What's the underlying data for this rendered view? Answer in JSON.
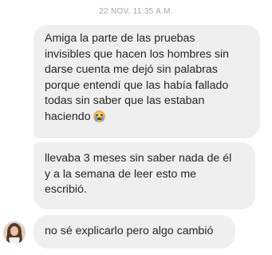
{
  "thread": {
    "timestamp": "22 NOV, 11:35 A.M.",
    "messages": [
      {
        "lines": [
          "Amiga la parte de las pruebas",
          "invisibles que hacen los hombres sin",
          "darse cuenta me dejó sin palabras",
          "porque entendí que las había fallado",
          "todas sin saber que las estaban",
          "haciendo"
        ],
        "emoji": "crying-face-emoji"
      },
      {
        "lines": [
          "llevaba 3 meses sin saber nada de él",
          "y a la semana de leer esto me",
          "escribió."
        ]
      },
      {
        "lines": [
          "no sé explicarlo pero algo cambió"
        ]
      }
    ],
    "avatar": "sender-avatar"
  },
  "colors": {
    "bubble": "#efefef",
    "text": "#262626",
    "timestamp": "#a8a8a8"
  }
}
